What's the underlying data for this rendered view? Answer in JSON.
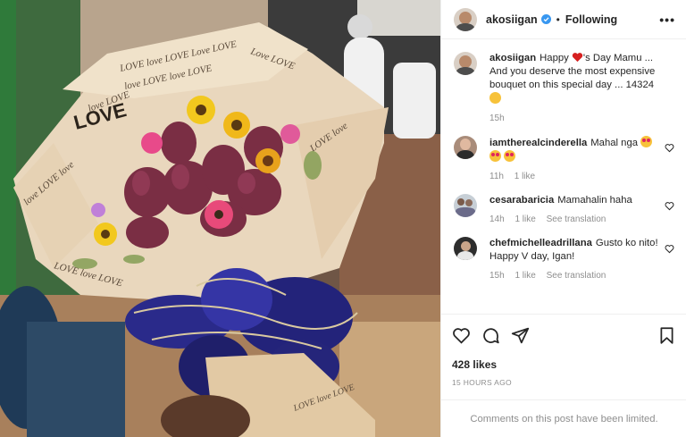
{
  "post": {
    "username": "akosiigan",
    "follow_status": "Following",
    "more_glyph": "•••",
    "caption_part1": "Happy ",
    "caption_part2": "'s Day Mamu ... And you deserve the most expensive bouquet on this special day ... 14324 ",
    "caption_time": "15h",
    "likes": "428 likes",
    "timestamp": "15 HOURS AGO",
    "comments_limited": "Comments on this post have been limited."
  },
  "comments": [
    {
      "user": "iamtherealcinderella",
      "text": "Mahal nga ",
      "time": "11h",
      "likes": "1 like",
      "translate": ""
    },
    {
      "user": "cesarabaricia",
      "text": "Mamahalin haha",
      "time": "14h",
      "likes": "1 like",
      "translate": "See translation"
    },
    {
      "user": "chefmichelleadrillana",
      "text": "Gusto ko nito! Happy V day, Igan!",
      "time": "15h",
      "likes": "1 like",
      "translate": "See translation"
    }
  ],
  "icons": {
    "like": "heart-icon",
    "comment": "comment-icon",
    "share": "share-icon",
    "save": "bookmark-icon",
    "verified": "verified-badge-icon"
  },
  "colors": {
    "verified_blue": "#3897f0",
    "meta_gray": "#8e8e8e",
    "heart_red": "#d62020",
    "divider": "#efefef"
  }
}
